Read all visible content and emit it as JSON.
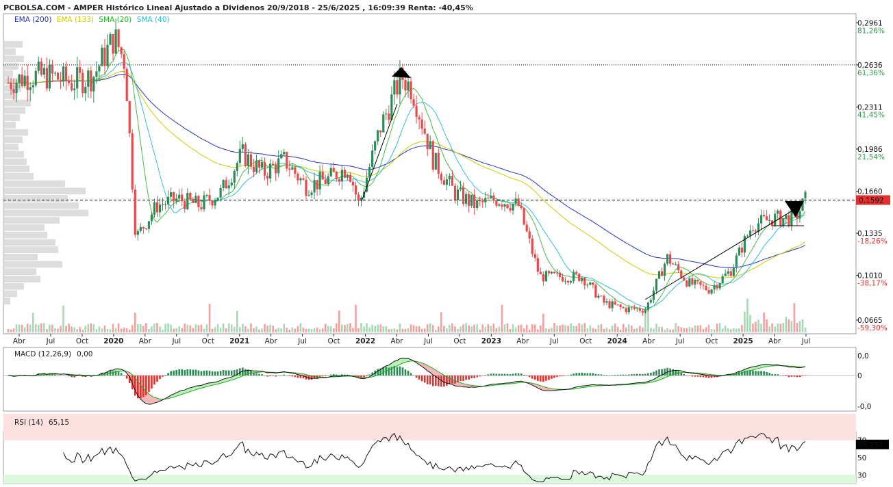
{
  "header": {
    "title": "PCBOLSA.COM - AMPER Histórico Lineal Ajustado a Dividenos 20/9/2018 - 25/6/2025 , 16:09:39 Renta: -40,45%"
  },
  "legend": [
    {
      "label": "EMA (200)",
      "color": "#2233bb"
    },
    {
      "label": "EMA (133)",
      "color": "#cccc00"
    },
    {
      "label": "SMA (20)",
      "color": "#22bb22"
    },
    {
      "label": "SMA (40)",
      "color": "#22bbdd"
    }
  ],
  "colors": {
    "up": "#2e8b57",
    "down": "#e8494a",
    "ema200": "#2233bb",
    "ema133": "#cccc00",
    "sma20": "#44bb44",
    "sma40": "#33bbdd",
    "volume_profile": "#dddddd",
    "macd_up": "#2e8b57",
    "macd_down": "#e03030",
    "rsi_over": "#fde0e0",
    "rsi_under": "#dcf8dc"
  },
  "price_axis": {
    "ticks": [
      {
        "value": 0.2961,
        "label": "0,2961",
        "pct": "81,26%",
        "pct_color": "#2e9e4e"
      },
      {
        "value": 0.2636,
        "label": "0,2636",
        "pct": "61,36%",
        "pct_color": "#2e9e4e"
      },
      {
        "value": 0.2311,
        "label": "0,2311",
        "pct": "41,45%",
        "pct_color": "#2e9e4e"
      },
      {
        "value": 0.1986,
        "label": "0,1986",
        "pct": "21,54%",
        "pct_color": "#2e9e4e"
      },
      {
        "value": 0.166,
        "label": "0,1660",
        "pct": "1,64%",
        "pct_color": "#2e9e4e"
      },
      {
        "value": 0.1335,
        "label": "0,1335",
        "pct": "-18,26%",
        "pct_color": "#e03030"
      },
      {
        "value": 0.101,
        "label": "0,1010",
        "pct": "-38,17%",
        "pct_color": "#e03030"
      },
      {
        "value": 0.0665,
        "label": "0,0665",
        "pct": "-59,30%",
        "pct_color": "#e03030"
      }
    ],
    "current_label": "0,1592",
    "current_value": 0.1592,
    "current_color": "#e03030",
    "reference_value": 0.2636
  },
  "time_axis": {
    "ticks": [
      {
        "label": "Abr",
        "bold": false
      },
      {
        "label": "Jul",
        "bold": false
      },
      {
        "label": "Oct",
        "bold": false
      },
      {
        "label": "2020",
        "bold": true
      },
      {
        "label": "Abr",
        "bold": false
      },
      {
        "label": "Jul",
        "bold": false
      },
      {
        "label": "Oct",
        "bold": false
      },
      {
        "label": "2021",
        "bold": true
      },
      {
        "label": "Abr",
        "bold": false
      },
      {
        "label": "Jul",
        "bold": false
      },
      {
        "label": "Oct",
        "bold": false
      },
      {
        "label": "2022",
        "bold": true
      },
      {
        "label": "Abr",
        "bold": false
      },
      {
        "label": "Jul",
        "bold": false
      },
      {
        "label": "Oct",
        "bold": false
      },
      {
        "label": "2023",
        "bold": true
      },
      {
        "label": "Abr",
        "bold": false
      },
      {
        "label": "Jul",
        "bold": false
      },
      {
        "label": "Oct",
        "bold": false
      },
      {
        "label": "2024",
        "bold": true
      },
      {
        "label": "Abr",
        "bold": false
      },
      {
        "label": "Jul",
        "bold": false
      },
      {
        "label": "Oct",
        "bold": false
      },
      {
        "label": "2025",
        "bold": true
      },
      {
        "label": "Abr",
        "bold": false
      },
      {
        "label": "Jul",
        "bold": false
      }
    ]
  },
  "chart_data": {
    "type": "candlestick",
    "title": "AMPER Histórico Lineal Ajustado a Dividenos 20/9/2018 - 25/6/2025",
    "x_start": "2019-03",
    "x_end": "2025-06",
    "ylim": [
      0.058,
      0.3
    ],
    "close_series": [
      {
        "date": "2019-03",
        "value": 0.25
      },
      {
        "date": "2019-05",
        "value": 0.255
      },
      {
        "date": "2019-07",
        "value": 0.255
      },
      {
        "date": "2019-09",
        "value": 0.25
      },
      {
        "date": "2019-11",
        "value": 0.255
      },
      {
        "date": "2020-01",
        "value": 0.285
      },
      {
        "date": "2020-02",
        "value": 0.265
      },
      {
        "date": "2020-03",
        "value": 0.13
      },
      {
        "date": "2020-05",
        "value": 0.155
      },
      {
        "date": "2020-07",
        "value": 0.16
      },
      {
        "date": "2020-09",
        "value": 0.155
      },
      {
        "date": "2020-11",
        "value": 0.165
      },
      {
        "date": "2021-01",
        "value": 0.195
      },
      {
        "date": "2021-03",
        "value": 0.18
      },
      {
        "date": "2021-05",
        "value": 0.19
      },
      {
        "date": "2021-07",
        "value": 0.17
      },
      {
        "date": "2021-09",
        "value": 0.175
      },
      {
        "date": "2021-11",
        "value": 0.185
      },
      {
        "date": "2021-12",
        "value": 0.155
      },
      {
        "date": "2022-02",
        "value": 0.215
      },
      {
        "date": "2022-04",
        "value": 0.255
      },
      {
        "date": "2022-05",
        "value": 0.245
      },
      {
        "date": "2022-07",
        "value": 0.19
      },
      {
        "date": "2022-09",
        "value": 0.165
      },
      {
        "date": "2022-11",
        "value": 0.155
      },
      {
        "date": "2023-01",
        "value": 0.16
      },
      {
        "date": "2023-03",
        "value": 0.155
      },
      {
        "date": "2023-05",
        "value": 0.1
      },
      {
        "date": "2023-07",
        "value": 0.1
      },
      {
        "date": "2023-09",
        "value": 0.1
      },
      {
        "date": "2023-11",
        "value": 0.08
      },
      {
        "date": "2024-01",
        "value": 0.075
      },
      {
        "date": "2024-03",
        "value": 0.075
      },
      {
        "date": "2024-05",
        "value": 0.115
      },
      {
        "date": "2024-07",
        "value": 0.095
      },
      {
        "date": "2024-09",
        "value": 0.09
      },
      {
        "date": "2024-11",
        "value": 0.105
      },
      {
        "date": "2025-01",
        "value": 0.14
      },
      {
        "date": "2025-03",
        "value": 0.145
      },
      {
        "date": "2025-05",
        "value": 0.145
      },
      {
        "date": "2025-06",
        "value": 0.1592
      }
    ],
    "indicators": [
      "EMA (200)",
      "EMA (133)",
      "SMA (20)",
      "SMA (40)"
    ]
  },
  "macd": {
    "title": "MACD (12,26,9)",
    "value": "0,00",
    "ticks": [
      {
        "value": 0.0,
        "label": "0,0",
        "color": "#e03030",
        "pos": "top"
      },
      {
        "value": 0,
        "label": "0",
        "color": "#111111",
        "pos": "mid"
      },
      {
        "value": -0.0,
        "label": "-0,0",
        "color": "#2e9e4e",
        "pos": "bottom"
      }
    ]
  },
  "rsi": {
    "title": "RSI (14)",
    "value": "65,15",
    "current_label": "65,157",
    "ticks": [
      {
        "value": 70,
        "label": "70"
      },
      {
        "value": 50,
        "label": "50"
      },
      {
        "value": 30,
        "label": "30"
      }
    ]
  }
}
